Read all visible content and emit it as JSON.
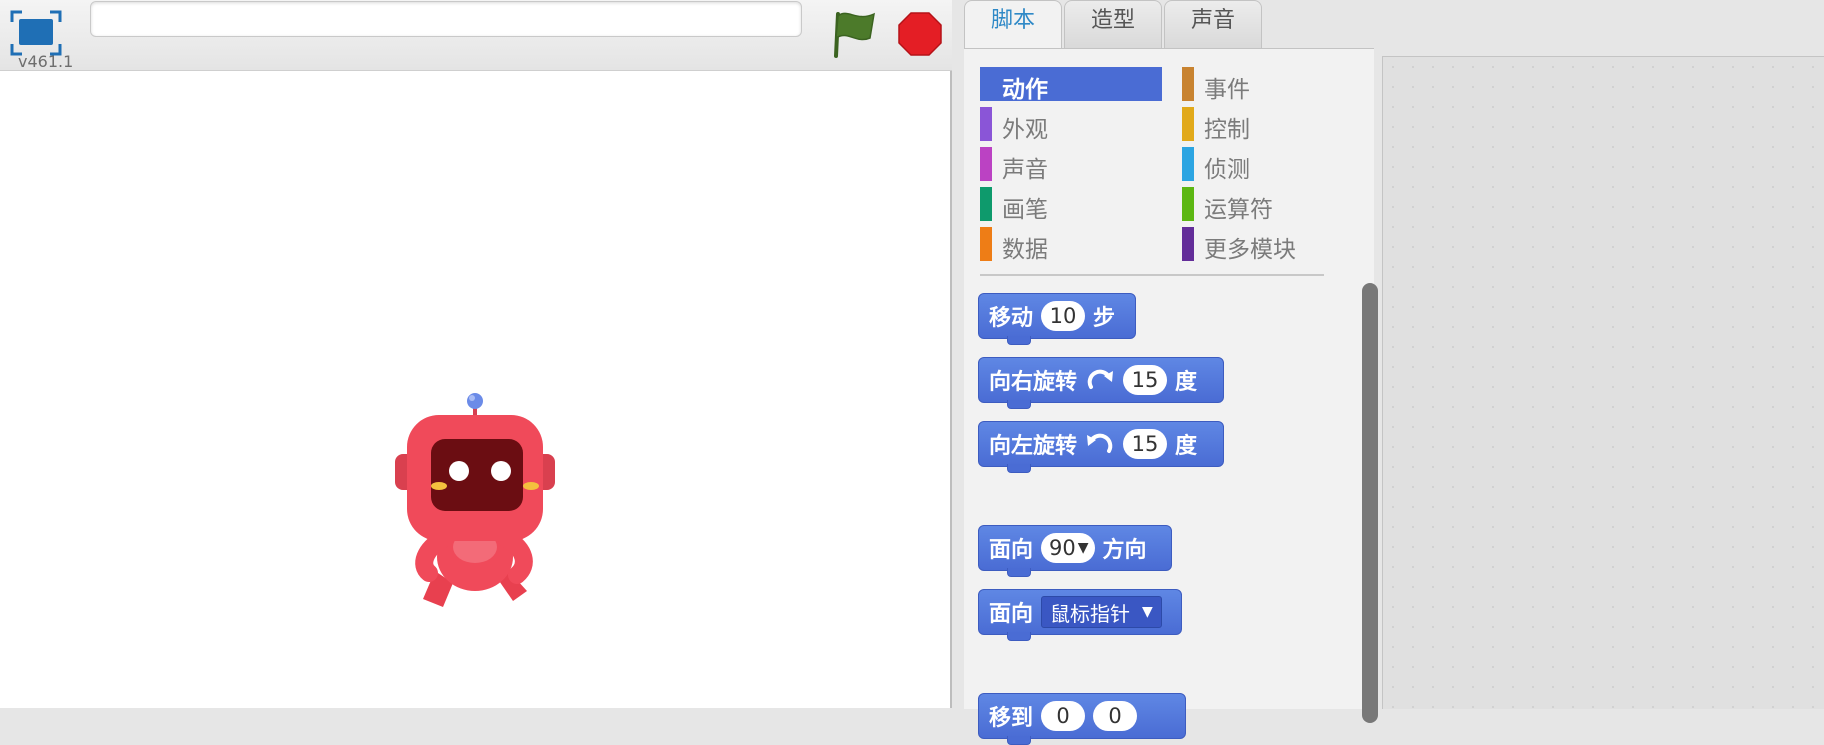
{
  "header": {
    "version": "v461.1",
    "project_title_value": "",
    "project_title_placeholder": ""
  },
  "tabs": [
    {
      "label": "脚本",
      "active": true
    },
    {
      "label": "造型",
      "active": false
    },
    {
      "label": "声音",
      "active": false
    }
  ],
  "categories": [
    {
      "label": "动作",
      "color": "#4a6cd4",
      "selected": true
    },
    {
      "label": "外观",
      "color": "#8a55d7"
    },
    {
      "label": "声音",
      "color": "#bb42c3"
    },
    {
      "label": "画笔",
      "color": "#0e9a6c"
    },
    {
      "label": "数据",
      "color": "#ee7d16"
    },
    {
      "label": "事件",
      "color": "#c88330"
    },
    {
      "label": "控制",
      "color": "#e1a91a"
    },
    {
      "label": "侦测",
      "color": "#2ca5e2"
    },
    {
      "label": "运算符",
      "color": "#5cb712"
    },
    {
      "label": "更多模块",
      "color": "#632d99"
    }
  ],
  "blocks": {
    "move": {
      "prefix": "移动",
      "value": "10",
      "suffix": "步"
    },
    "turn_right": {
      "prefix": "向右旋转",
      "value": "15",
      "suffix": "度"
    },
    "turn_left": {
      "prefix": "向左旋转",
      "value": "15",
      "suffix": "度"
    },
    "point_direction": {
      "prefix": "面向",
      "value": "90",
      "suffix": "方向"
    },
    "point_towards": {
      "prefix": "面向",
      "menu": "鼠标指针"
    },
    "goto_xy": {
      "prefix": "移到",
      "x": "0",
      "y": "0"
    }
  },
  "colors": {
    "motion": "#4a6cd4",
    "tab_active_text": "#2f89c7",
    "flag_green": "#4c7a2a",
    "stop_red": "#e41e25",
    "robot_red": "#f04a5a"
  },
  "icons": [
    "fullscreen-icon",
    "green-flag-icon",
    "stop-icon",
    "rotate-right-icon",
    "rotate-left-icon"
  ]
}
